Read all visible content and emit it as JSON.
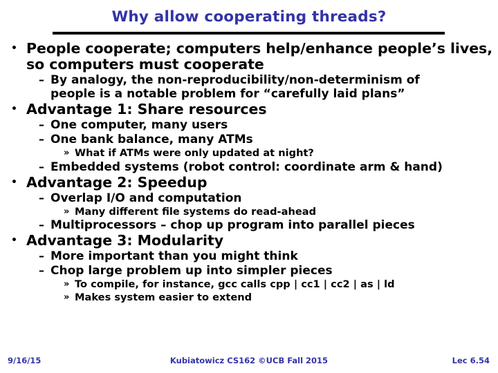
{
  "slide": {
    "title": "Why allow cooperating threads?",
    "title_color": "#3333a8",
    "rule_color": "#000000",
    "background": "#ffffff",
    "text_color": "#000000"
  },
  "bullets": {
    "b1": {
      "mark": "•",
      "line1": "People cooperate; computers help/enhance people’s lives,",
      "line2": "so computers must cooperate"
    },
    "b1s1": {
      "mark": "–",
      "line1": "By analogy, the non-reproducibility/non-determinism of",
      "line2": "people is a notable problem for “carefully laid plans”"
    },
    "b2": {
      "mark": "•",
      "text": "Advantage 1: Share resources"
    },
    "b2s1": {
      "mark": "–",
      "text": "One computer, many users"
    },
    "b2s2": {
      "mark": "–",
      "text": "One bank balance, many ATMs"
    },
    "b2s2a": {
      "mark": "»",
      "text": "What if ATMs were only updated at night?"
    },
    "b2s3": {
      "mark": "–",
      "text": "Embedded systems (robot control: coordinate arm & hand)"
    },
    "b3": {
      "mark": "•",
      "text": "Advantage 2: Speedup"
    },
    "b3s1": {
      "mark": "–",
      "text": "Overlap I/O and computation"
    },
    "b3s1a": {
      "mark": "»",
      "text": "Many different file systems do read-ahead"
    },
    "b3s2": {
      "mark": "–",
      "text": "Multiprocessors – chop up program into parallel pieces"
    },
    "b4": {
      "mark": "•",
      "text": "Advantage 3: Modularity"
    },
    "b4s1": {
      "mark": "–",
      "text": "More important than you might think"
    },
    "b4s2": {
      "mark": "–",
      "text": "Chop large problem up into simpler pieces"
    },
    "b4s2a": {
      "mark": "»",
      "text": "To compile, for instance, gcc calls cpp | cc1 | cc2 | as | ld"
    },
    "b4s2b": {
      "mark": "»",
      "text": "Makes system easier to extend"
    }
  },
  "footer": {
    "date": "9/16/15",
    "center": "Kubiatowicz CS162 ©UCB Fall 2015",
    "page": "Lec 6.54",
    "color": "#3333a8"
  }
}
